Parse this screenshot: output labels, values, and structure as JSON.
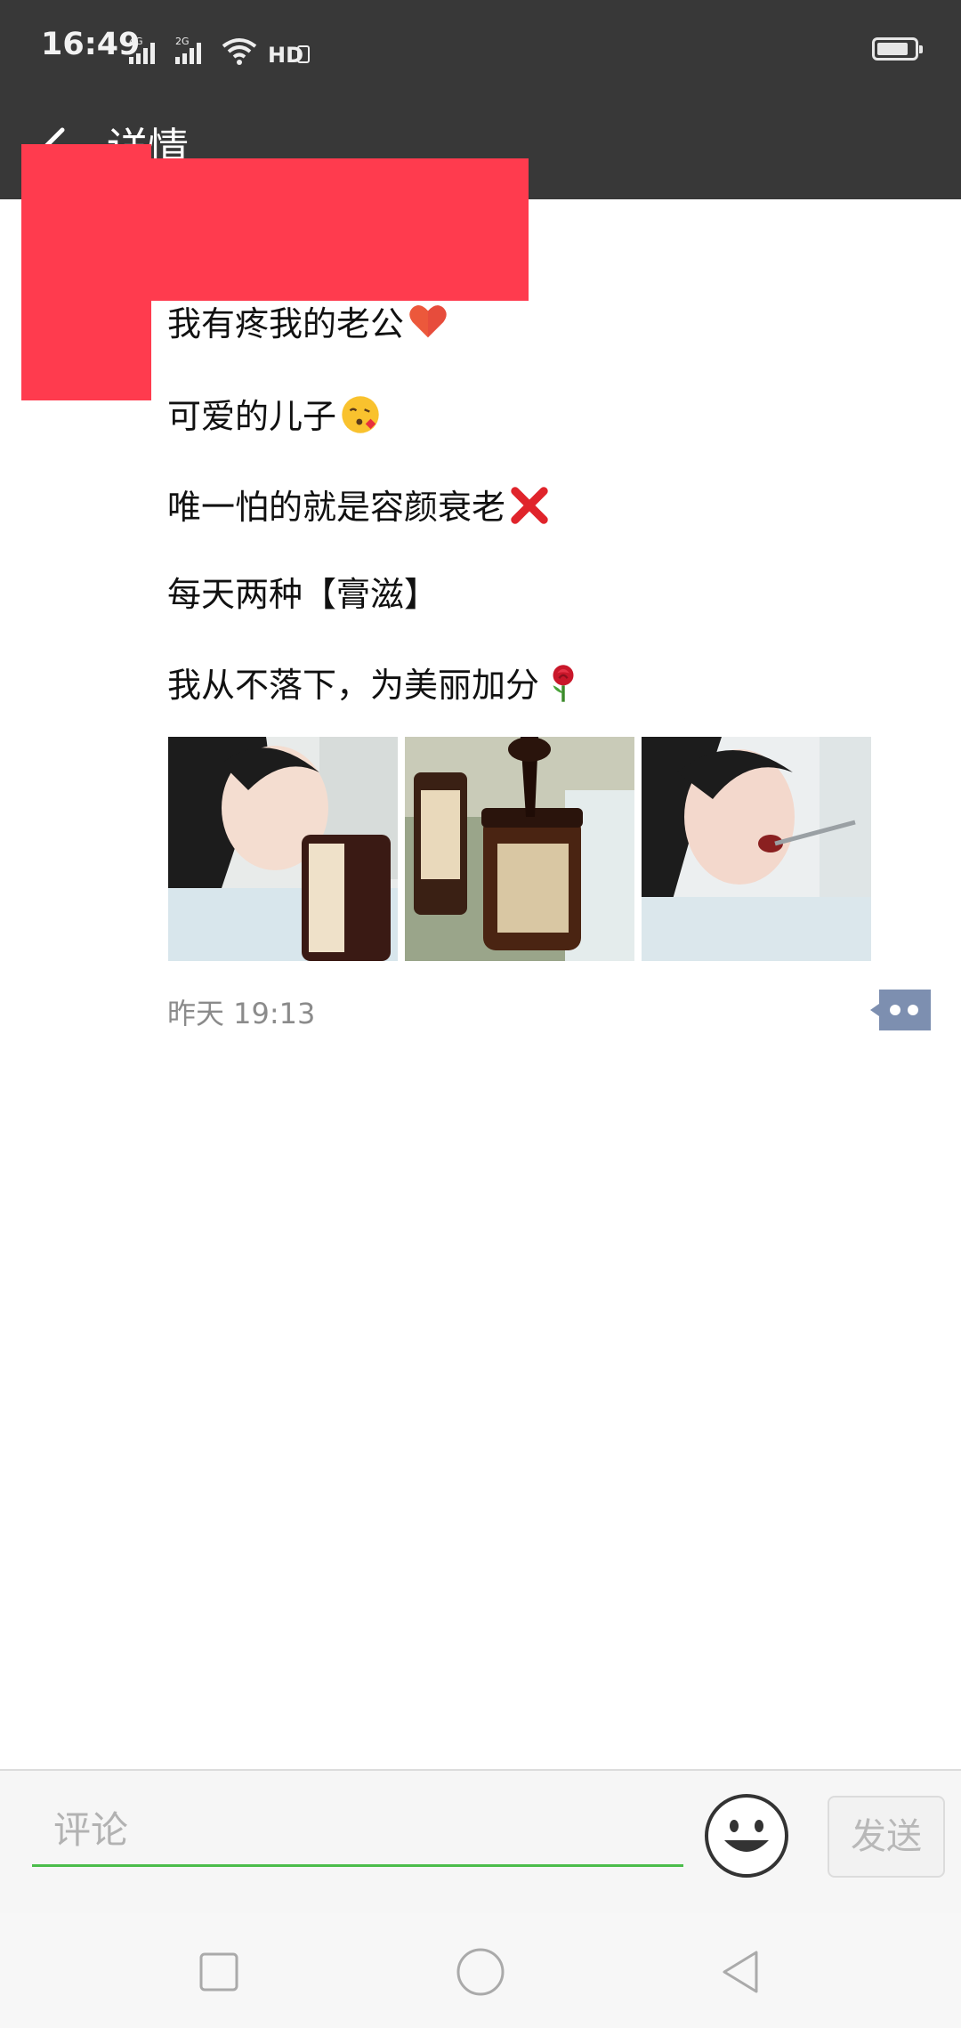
{
  "status_bar": {
    "time": "16:49",
    "signal1_label": "4G",
    "signal2_label": "2G",
    "hd_label": "HD",
    "battery_level": 0.85
  },
  "nav": {
    "title": "详情",
    "back_icon": "chevron-left-icon"
  },
  "post": {
    "lines": [
      {
        "text": "我有疼我的老公",
        "emoji": "heart-icon"
      },
      {
        "text": "可爱的儿子",
        "emoji": "kissing-face-icon"
      },
      {
        "text": "唯一怕的就是容颜衰老",
        "emoji": "cross-mark-icon"
      },
      {
        "text": "每天两种【膏滋】",
        "emoji": ""
      },
      {
        "text": "我从不落下，为美丽加分",
        "emoji": "rose-icon"
      }
    ],
    "photo_count": 3,
    "timestamp": "昨天 19:13"
  },
  "comment_bar": {
    "placeholder": "评论",
    "send_label": "发送",
    "accent_color": "#4bbd4b"
  },
  "system_nav": {
    "buttons": [
      "recent-apps-icon",
      "home-icon",
      "back-triangle-icon"
    ]
  }
}
